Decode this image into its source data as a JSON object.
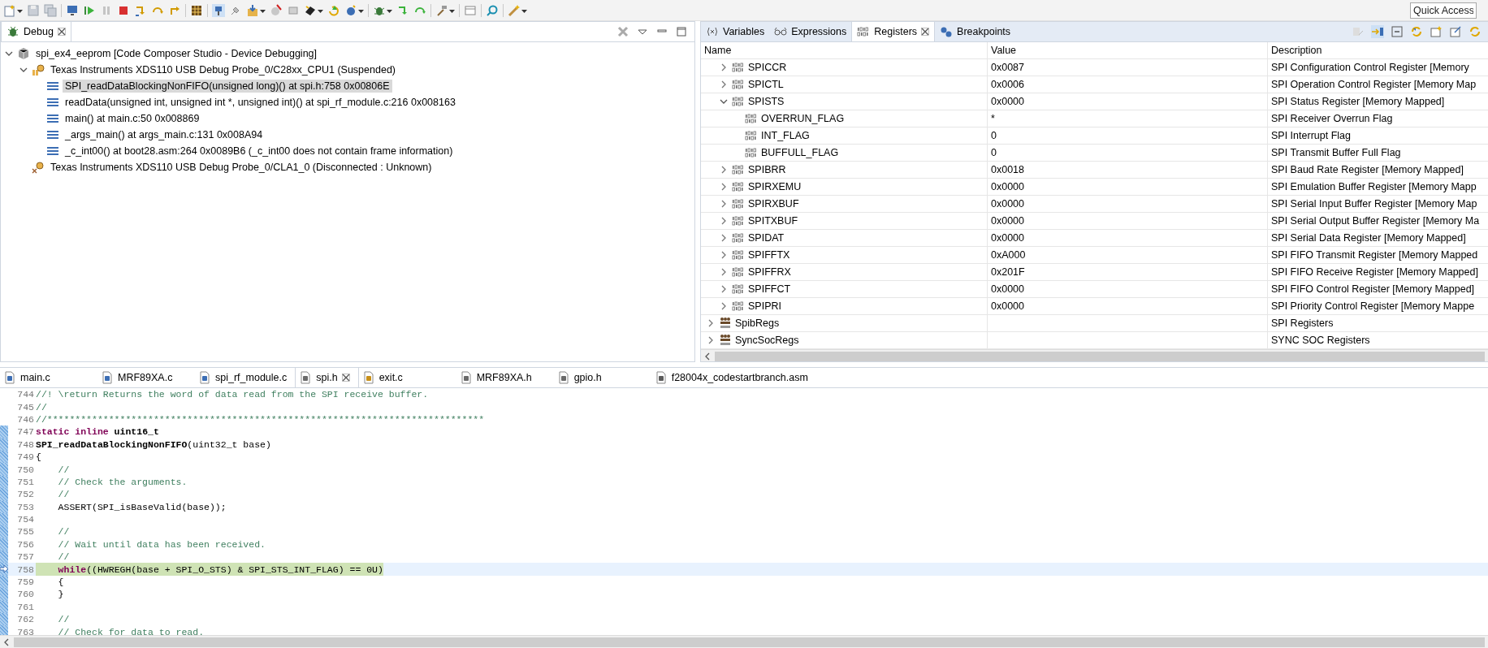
{
  "toolbar": {
    "quick_access": {
      "placeholder": "Quick Access"
    }
  },
  "debug_view": {
    "tab": {
      "label": "Debug",
      "selected": true
    },
    "tree": [
      {
        "kind": "launch",
        "label": "spi_ex4_eeprom [Code Composer Studio - Device Debugging]",
        "expanded": true,
        "children": [
          {
            "kind": "device",
            "label": "Texas Instruments XDS110 USB Debug Probe_0/C28xx_CPU1 (Suspended)",
            "expanded": true,
            "disconnected": false,
            "children": [
              {
                "kind": "frame",
                "label": "SPI_readDataBlockingNonFIFO(unsigned long)() at spi.h:758 0x00806E",
                "selected": true
              },
              {
                "kind": "frame",
                "label": "readData(unsigned int, unsigned int *, unsigned int)() at spi_rf_module.c:216 0x008163",
                "selected": false
              },
              {
                "kind": "frame",
                "label": "main() at main.c:50 0x008869",
                "selected": false
              },
              {
                "kind": "frame",
                "label": "_args_main() at args_main.c:131 0x008A94",
                "selected": false
              },
              {
                "kind": "frame",
                "label": "_c_int00() at boot28.asm:264 0x0089B6  (_c_int00 does not contain frame information)",
                "selected": false
              }
            ]
          },
          {
            "kind": "device",
            "label": "Texas Instruments XDS110 USB Debug Probe_0/CLA1_0 (Disconnected : Unknown)",
            "disconnected": true
          }
        ]
      }
    ]
  },
  "registers_view": {
    "tabs": [
      {
        "kind": "variables",
        "label": "Variables",
        "selected": false
      },
      {
        "kind": "expressions",
        "label": "Expressions",
        "selected": false
      },
      {
        "kind": "registers",
        "label": "Registers",
        "selected": true
      },
      {
        "kind": "breakpoints",
        "label": "Breakpoints",
        "selected": false
      }
    ],
    "columns": [
      "Name",
      "Value",
      "Description"
    ],
    "rows": [
      {
        "kind": "register",
        "name": "SPICCR",
        "value": "0x0087",
        "description": "SPI Configuration Control Register [Memory",
        "expanded": false
      },
      {
        "kind": "register",
        "name": "SPICTL",
        "value": "0x0006",
        "description": "SPI Operation Control Register [Memory Map",
        "expanded": false
      },
      {
        "kind": "register",
        "name": "SPISTS",
        "value": "0x0000",
        "description": "SPI Status Register [Memory Mapped]",
        "expanded": true,
        "children": [
          {
            "kind": "field",
            "name": "OVERRUN_FLAG",
            "value": "*",
            "description": "SPI Receiver Overrun Flag"
          },
          {
            "kind": "field",
            "name": "INT_FLAG",
            "value": "0",
            "description": "SPI Interrupt Flag"
          },
          {
            "kind": "field",
            "name": "BUFFULL_FLAG",
            "value": "0",
            "description": "SPI Transmit Buffer Full Flag"
          }
        ]
      },
      {
        "kind": "register",
        "name": "SPIBRR",
        "value": "0x0018",
        "description": "SPI Baud Rate Register [Memory Mapped]",
        "expanded": false
      },
      {
        "kind": "register",
        "name": "SPIRXEMU",
        "value": "0x0000",
        "description": "SPI Emulation Buffer Register [Memory Mapp",
        "expanded": false
      },
      {
        "kind": "register",
        "name": "SPIRXBUF",
        "value": "0x0000",
        "description": "SPI Serial Input Buffer Register [Memory Map",
        "expanded": false
      },
      {
        "kind": "register",
        "name": "SPITXBUF",
        "value": "0x0000",
        "description": "SPI Serial Output Buffer Register [Memory Ma",
        "expanded": false
      },
      {
        "kind": "register",
        "name": "SPIDAT",
        "value": "0x0000",
        "description": "SPI Serial Data Register [Memory Mapped]",
        "expanded": false
      },
      {
        "kind": "register",
        "name": "SPIFFTX",
        "value": "0xA000",
        "description": "SPI FIFO Transmit Register [Memory Mapped",
        "expanded": false
      },
      {
        "kind": "register",
        "name": "SPIFFRX",
        "value": "0x201F",
        "description": "SPI FIFO Receive Register [Memory Mapped]",
        "expanded": false
      },
      {
        "kind": "register",
        "name": "SPIFFCT",
        "value": "0x0000",
        "description": "SPI FIFO Control Register [Memory Mapped]",
        "expanded": false
      },
      {
        "kind": "register",
        "name": "SPIPRI",
        "value": "0x0000",
        "description": "SPI Priority Control Register [Memory Mappe",
        "expanded": false
      },
      {
        "kind": "group",
        "name": "SpibRegs",
        "description": "SPI Registers",
        "expanded": false
      },
      {
        "kind": "group",
        "name": "SyncSocRegs",
        "description": "SYNC SOC Registers",
        "expanded": false
      }
    ]
  },
  "editor": {
    "tabs": [
      {
        "kind": "c",
        "label": "main.c",
        "selected": false
      },
      {
        "kind": "c",
        "label": "MRF89XA.c",
        "selected": false
      },
      {
        "kind": "c",
        "label": "spi_rf_module.c",
        "selected": false
      },
      {
        "kind": "h",
        "label": "spi.h",
        "selected": true
      },
      {
        "kind": "c_linked",
        "label": "exit.c",
        "selected": false
      },
      {
        "kind": "h",
        "label": "MRF89XA.h",
        "selected": false
      },
      {
        "kind": "h",
        "label": "gpio.h",
        "selected": false
      },
      {
        "kind": "asm",
        "label": "f28004x_codestartbranch.asm",
        "selected": false
      }
    ],
    "lines": [
      {
        "number": "744",
        "marked": false,
        "current": false,
        "segments": [
          {
            "kind": "comment",
            "text": "//! \\return Returns the word of data read from the SPI receive buffer."
          }
        ]
      },
      {
        "number": "745",
        "marked": false,
        "current": false,
        "segments": [
          {
            "kind": "comment",
            "text": "//"
          }
        ]
      },
      {
        "number": "746",
        "marked": false,
        "current": false,
        "segments": [
          {
            "kind": "comment",
            "text": "//******************************************************************************"
          }
        ]
      },
      {
        "number": "747",
        "marked": true,
        "current": false,
        "segments": [
          {
            "kind": "keyword",
            "text": "static inline"
          },
          {
            "kind": "bold",
            "text": " uint16_t"
          }
        ]
      },
      {
        "number": "748",
        "marked": true,
        "current": false,
        "segments": [
          {
            "kind": "bold",
            "text": "SPI_readDataBlockingNonFIFO"
          },
          {
            "kind": "plain",
            "text": "(uint32_t base)"
          }
        ]
      },
      {
        "number": "749",
        "marked": true,
        "current": false,
        "segments": [
          {
            "kind": "plain",
            "text": "{"
          }
        ]
      },
      {
        "number": "750",
        "marked": true,
        "current": false,
        "segments": [
          {
            "kind": "comment",
            "text": "    //"
          }
        ]
      },
      {
        "number": "751",
        "marked": true,
        "current": false,
        "segments": [
          {
            "kind": "comment",
            "text": "    // Check the arguments."
          }
        ]
      },
      {
        "number": "752",
        "marked": true,
        "current": false,
        "segments": [
          {
            "kind": "comment",
            "text": "    //"
          }
        ]
      },
      {
        "number": "753",
        "marked": true,
        "current": false,
        "segments": [
          {
            "kind": "plain",
            "text": "    ASSERT(SPI_isBaseValid(base));"
          }
        ]
      },
      {
        "number": "754",
        "marked": true,
        "current": false
      },
      {
        "number": "755",
        "marked": true,
        "current": false,
        "segments": [
          {
            "kind": "comment",
            "text": "    //"
          }
        ]
      },
      {
        "number": "756",
        "marked": true,
        "current": false,
        "segments": [
          {
            "kind": "comment",
            "text": "    // Wait until data has been received."
          }
        ]
      },
      {
        "number": "757",
        "marked": true,
        "current": false,
        "segments": [
          {
            "kind": "comment",
            "text": "    //"
          }
        ]
      },
      {
        "number": "758",
        "marked": true,
        "current": true,
        "segments": [
          {
            "kind": "keyword",
            "text": "    while"
          },
          {
            "kind": "plain",
            "text": "((HWREGH(base + SPI_O_STS) & SPI_STS_INT_FLAG) == 0U)"
          }
        ]
      },
      {
        "number": "759",
        "marked": true,
        "current": false,
        "segments": [
          {
            "kind": "plain",
            "text": "    {"
          }
        ]
      },
      {
        "number": "760",
        "marked": true,
        "current": false,
        "segments": [
          {
            "kind": "plain",
            "text": "    }"
          }
        ]
      },
      {
        "number": "761",
        "marked": true,
        "current": false
      },
      {
        "number": "762",
        "marked": true,
        "current": false,
        "segments": [
          {
            "kind": "comment",
            "text": "    //"
          }
        ]
      },
      {
        "number": "763",
        "marked": true,
        "current": false,
        "segments": [
          {
            "kind": "comment",
            "text": "    // Check for data to read."
          }
        ]
      }
    ]
  }
}
